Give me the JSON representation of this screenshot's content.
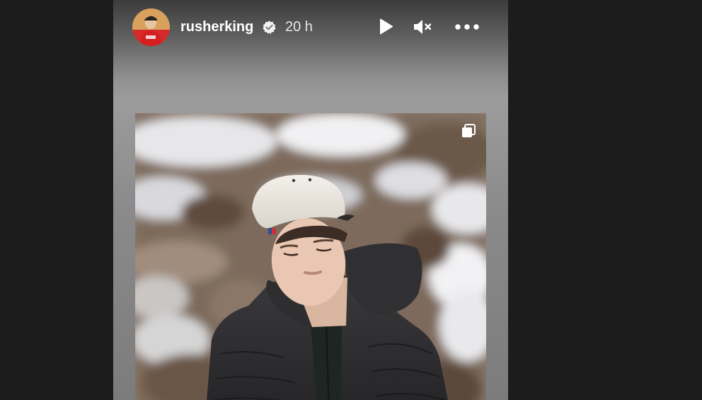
{
  "story": {
    "username": "rusherking",
    "verified": true,
    "timestamp": "20 h",
    "controls": {
      "play_icon": "play-icon",
      "mute_icon": "muted-speaker-icon",
      "more_icon": "more-horizontal-icon"
    },
    "media": {
      "type": "photo",
      "multi_item_icon": "carousel-icon"
    }
  },
  "colors": {
    "page_background": "#1c1c1c",
    "header_text": "#ffffff",
    "timestamp_text": "#e6e6e6"
  }
}
